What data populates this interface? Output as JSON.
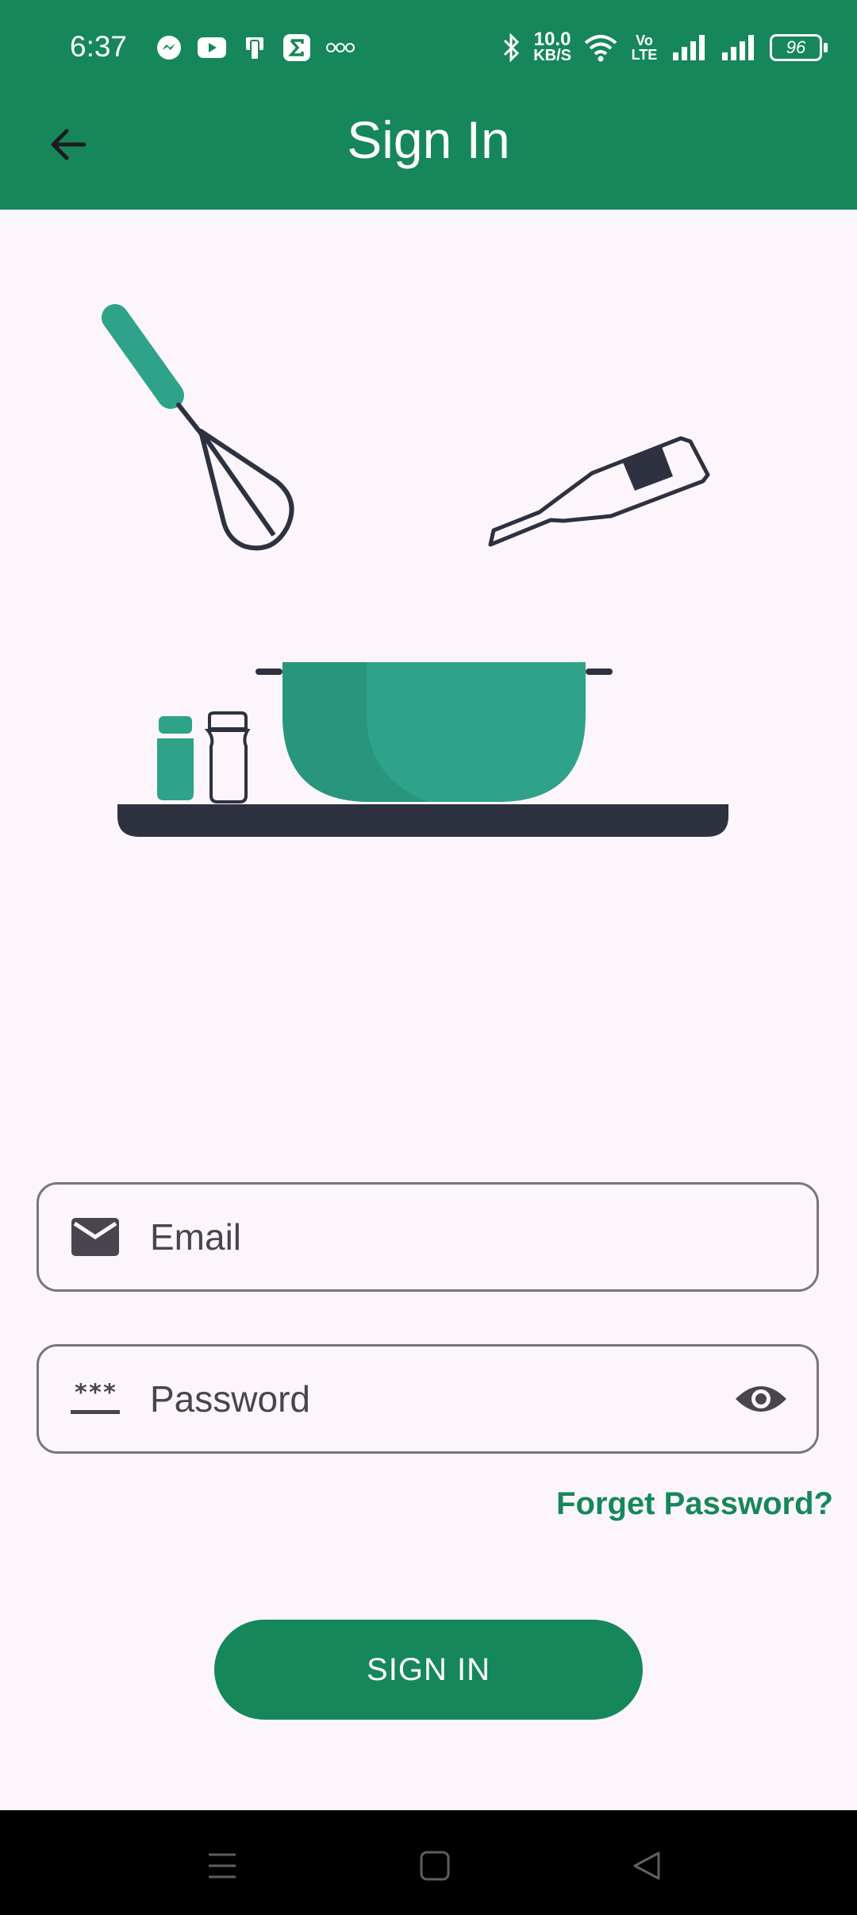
{
  "status_bar": {
    "time": "6:37",
    "speed_value": "10.0",
    "speed_unit": "KB/S",
    "volte": "Vo LTE",
    "battery": "96"
  },
  "app_bar": {
    "title": "Sign In",
    "back_icon": "arrow-back-icon"
  },
  "form": {
    "email": {
      "placeholder": "Email",
      "value": "",
      "icon": "mail-icon"
    },
    "password": {
      "placeholder": "Password",
      "value": "",
      "icon": "password-icon",
      "toggle_icon": "eye-icon"
    },
    "forgot_label": "Forget Password?",
    "submit_label": "SIGN IN"
  },
  "colors": {
    "primary": "#16875b",
    "accent": "#2fa38a",
    "dark": "#2e3140",
    "background": "#fcf6fc"
  },
  "nav_bar": {
    "icons": [
      "menu-icon",
      "home-square-icon",
      "back-triangle-icon"
    ]
  }
}
